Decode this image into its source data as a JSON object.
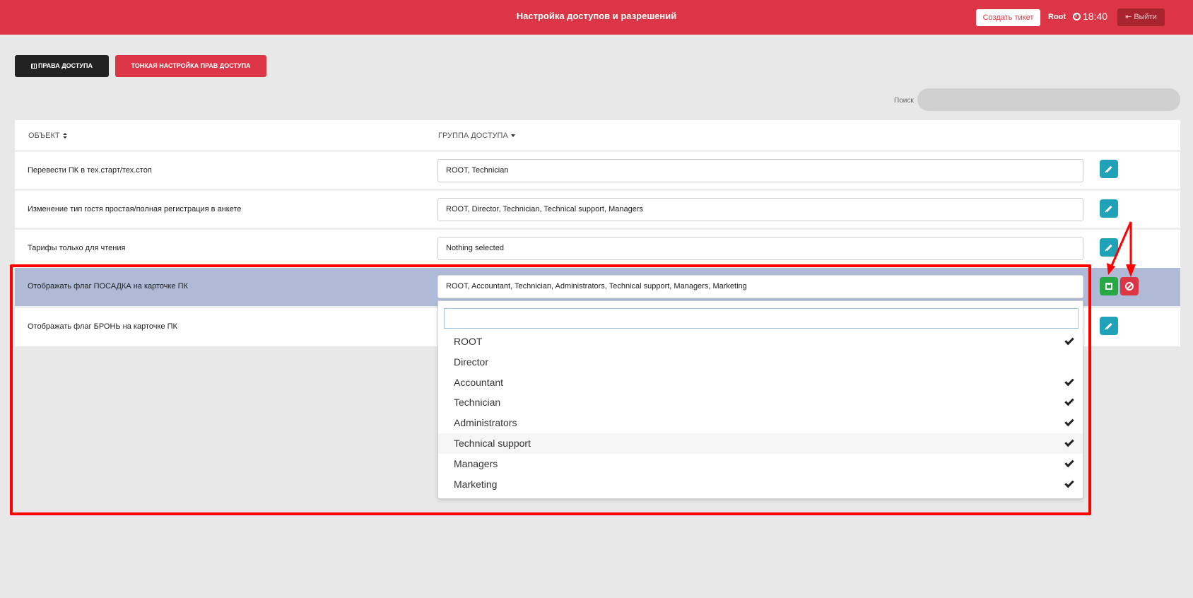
{
  "header": {
    "title": "Настройка доступов и разрешений",
    "create_ticket": "Создать тикет",
    "user": "Root",
    "time": "18:40",
    "logout": "Выйти"
  },
  "tabs": {
    "access_rights": "ПРАВА ДОСТУПА",
    "fine_tuning": "ТОНКАЯ НАСТРОЙКА ПРАВ ДОСТУПА"
  },
  "search": {
    "label": "Поиск",
    "value": ""
  },
  "table": {
    "columns": {
      "object": "ОБЪЕКТ",
      "group": "ГРУППА ДОСТУПА"
    },
    "rows": [
      {
        "object": "Перевести ПК в тех.старт/тех.стоп",
        "group": "ROOT, Technician"
      },
      {
        "object": "Изменение тип гостя простая/полная регистрация в анкете",
        "group": "ROOT, Director, Technician, Technical support, Managers"
      },
      {
        "object": "Тарифы только для чтения",
        "group": "Nothing selected"
      },
      {
        "object": "Отображать флаг ПОСАДКА на карточке ПК",
        "group": "ROOT, Accountant, Technician, Administrators, Technical support, Managers, Marketing"
      },
      {
        "object": "Отображать флаг БРОНЬ на карточке ПК",
        "group": ""
      }
    ]
  },
  "dropdown": {
    "search_value": "",
    "options": [
      {
        "label": "ROOT",
        "checked": true
      },
      {
        "label": "Director",
        "checked": false
      },
      {
        "label": "Accountant",
        "checked": true
      },
      {
        "label": "Technician",
        "checked": true
      },
      {
        "label": "Administrators",
        "checked": true
      },
      {
        "label": "Technical support",
        "checked": true
      },
      {
        "label": "Managers",
        "checked": true
      },
      {
        "label": "Marketing",
        "checked": true
      }
    ]
  },
  "colors": {
    "brand_red": "#dc3545",
    "edit_teal": "#1fa2b8",
    "save_green": "#28a745",
    "selected_row": "#aebad6",
    "annotation_red": "#ff0000"
  }
}
